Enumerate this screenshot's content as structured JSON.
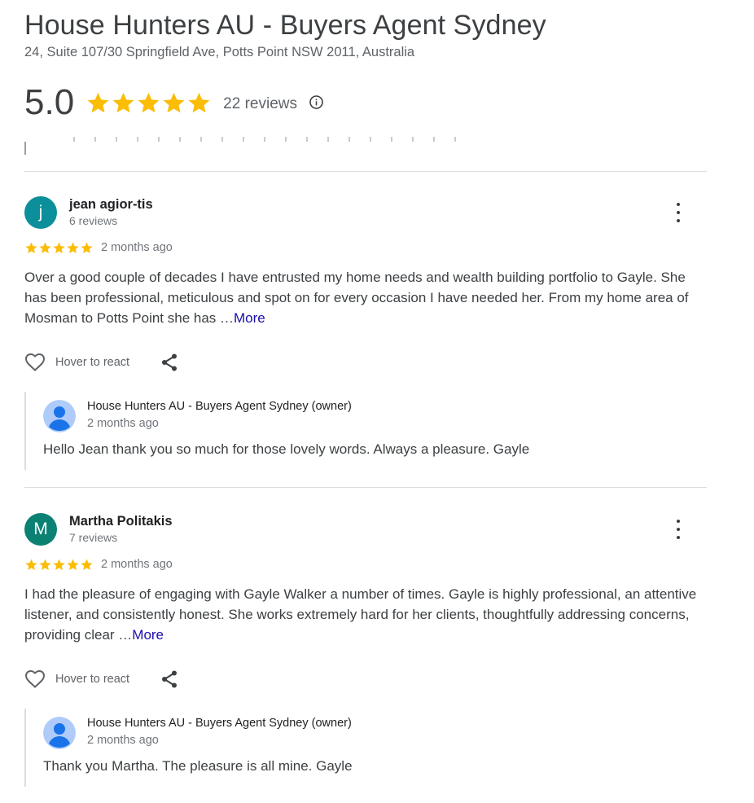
{
  "business": {
    "name": "House Hunters AU - Buyers Agent Sydney",
    "address": "24, Suite 107/30 Springfield Ave, Potts Point NSW 2011, Australia",
    "rating": "5.0",
    "stars": 5,
    "reviews_label": "22 reviews"
  },
  "colors": {
    "star": "#fbbc04",
    "link": "#1a0dab",
    "avatar_jean": "#0b8f9a",
    "avatar_martha": "#0b8174",
    "owner_avatar_bg": "#aecbfa",
    "owner_avatar_fg": "#1a73e8"
  },
  "icons": {
    "info": "info-icon",
    "more": "more-vert-icon",
    "react": "heart-icon",
    "share": "share-icon"
  },
  "reviews": [
    {
      "initial": "j",
      "name": "jean agior-tis",
      "meta": "6 reviews",
      "stars": 5,
      "date": "2 months ago",
      "text": "Over a good couple of decades I have entrusted my home needs and wealth building portfolio to Gayle. She has been professional, meticulous and spot on for every occasion I have needed her. From my home area of Mosman to Potts Point she has …",
      "more_label": "More",
      "react_label": "Hover to react",
      "owner_name": "House Hunters AU - Buyers Agent Sydney (owner)",
      "owner_date": "2 months ago",
      "owner_reply": "Hello Jean thank you so much for those lovely words. Always a pleasure. Gayle"
    },
    {
      "initial": "M",
      "name": "Martha Politakis",
      "meta": "7 reviews",
      "stars": 5,
      "date": "2 months ago",
      "text": "I had the pleasure of engaging with Gayle Walker a number of times. Gayle is highly professional, an attentive listener, and consistently honest. She works extremely hard for her clients, thoughtfully addressing concerns, providing clear …",
      "more_label": "More",
      "react_label": "Hover to react",
      "owner_name": "House Hunters AU - Buyers Agent Sydney (owner)",
      "owner_date": "2 months ago",
      "owner_reply": "Thank you Martha. The pleasure is all mine. Gayle"
    }
  ]
}
